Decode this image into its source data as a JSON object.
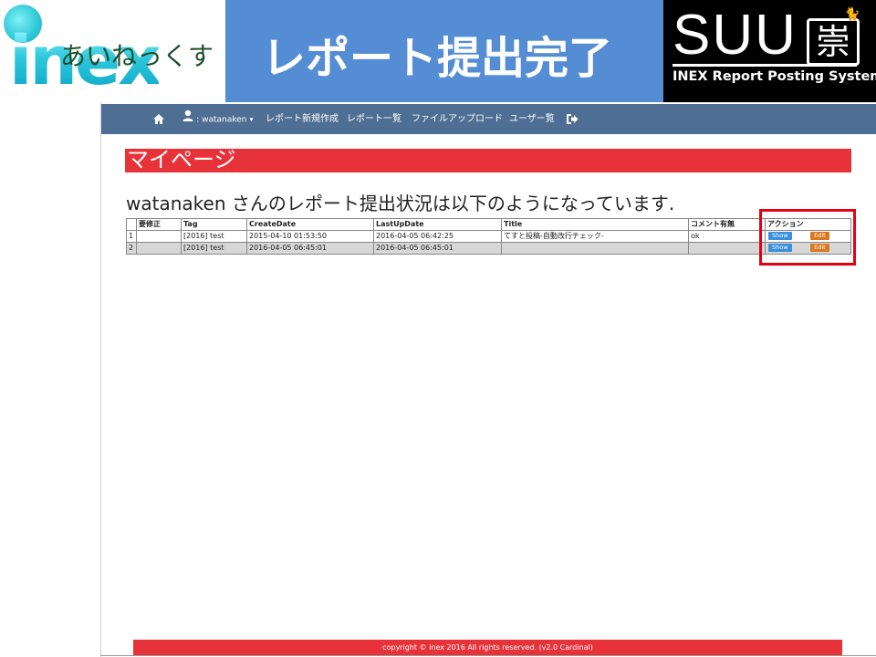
{
  "slide": {
    "logo_word": "inex",
    "logo_kana": "あいねっくす",
    "title": "レポート提出完了",
    "brand": {
      "name": "SUU",
      "kanji": "崇",
      "subtitle": "INEX Report Posting System"
    }
  },
  "navbar": {
    "home_icon": "home-icon",
    "user_icon": "user-icon",
    "user_label": ": watanaken",
    "user_caret": "▾",
    "items": [
      {
        "label": "レポート新規作成"
      },
      {
        "label": "レポート一覧"
      },
      {
        "label": "ファイルアップロード"
      },
      {
        "label": "ユーザー覧"
      }
    ],
    "logout_icon": "sign-out-icon"
  },
  "page": {
    "header": "マイページ",
    "status_heading": "watanaken さんのレポート提出状況は以下のようになっています."
  },
  "table": {
    "columns": [
      "",
      "要修正",
      "Tag",
      "CreateDate",
      "LastUpDate",
      "Title",
      "コメント有無",
      "アクション"
    ],
    "rows": [
      {
        "no": "1",
        "fix": "",
        "tag": "[2016] test",
        "create": "2015-04-10 01:53:50",
        "update": "2016-04-05 06:42:25",
        "title": "てすと投稿-自動改行チェック-",
        "comment": "ok",
        "show": "Show",
        "edit": "Edit"
      },
      {
        "no": "2",
        "fix": "",
        "tag": "[2016] test",
        "create": "2016-04-05 06:45:01",
        "update": "2016-04-05 06:45:01",
        "title": "",
        "comment": "",
        "show": "Show",
        "edit": "Edit"
      }
    ]
  },
  "footer": {
    "text": "copyright © inex 2016 All rights reserved. (v2.0 Cardinal)"
  },
  "colors": {
    "title_bar": "#548dd4",
    "navbar": "#4e6f93",
    "accent_red": "#e8323a",
    "highlight": "#e60012",
    "show_button": "#3a8fde",
    "edit_button": "#d9781f"
  }
}
